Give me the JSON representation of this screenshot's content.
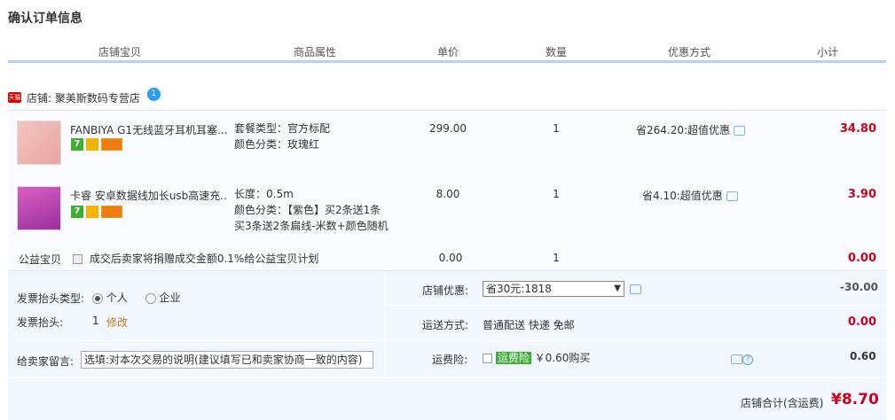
{
  "page_title": "确认订单信息",
  "columns": [
    "店铺宝贝",
    "商品属性",
    "单价",
    "数量",
    "优惠方式",
    "小计"
  ],
  "shop": {
    "badge": "天猫",
    "label": "店铺: 聚美斯数码专营店",
    "chat_badge": "1"
  },
  "items": [
    {
      "name": "FANBIYA G1无线蓝牙耳机耳塞...",
      "badge7": "7",
      "attrs": [
        "套餐类型：官方标配",
        "颜色分类：玫瑰红"
      ],
      "price": "299.00",
      "qty": "1",
      "promo": "省264.20:超值优惠",
      "subtotal": "34.80"
    },
    {
      "name": "卡睿 安卓数据线加长usb高速充...",
      "badge7": "7",
      "attrs": [
        "长度：0.5m",
        "颜色分类：【紫色】买2条送1条",
        "买3条送2条扁线-米数+颜色随机"
      ],
      "price": "8.00",
      "qty": "1",
      "promo": "省4.10:超值优惠",
      "subtotal": "3.90"
    }
  ],
  "charity": {
    "label": "公益宝贝",
    "text": "成交后卖家将捐赠成交金额0.1%给公益宝贝计划",
    "price": "0.00",
    "qty": "1",
    "subtotal": "0.00"
  },
  "invoice": {
    "type_label": "发票抬头类型:",
    "option_personal": "个人",
    "option_company": "企业",
    "header_label": "发票抬头:",
    "header_value": "1",
    "edit": "修改"
  },
  "message": {
    "label": "给卖家留言:",
    "placeholder": "选填:对本次交易的说明(建议填写已和卖家协商一致的内容)"
  },
  "shop_discount": {
    "label": "店铺优惠:",
    "selected": "省30元:1818",
    "value": "-30.00"
  },
  "shipping": {
    "label": "运送方式:",
    "text": "普通配送 快递 免邮",
    "value": "0.00"
  },
  "insurance": {
    "label": "运费险:",
    "badge": "运费险",
    "text": "￥0.60购买",
    "value": "0.60"
  },
  "total": {
    "label": "店铺合计(含运费)",
    "value": "¥8.70"
  },
  "colors": {
    "accent_red": "#d0021b",
    "header_line": "#b2d1ff",
    "panel_bg": "#f2f7ff",
    "insurance_green": "#3cb034"
  }
}
